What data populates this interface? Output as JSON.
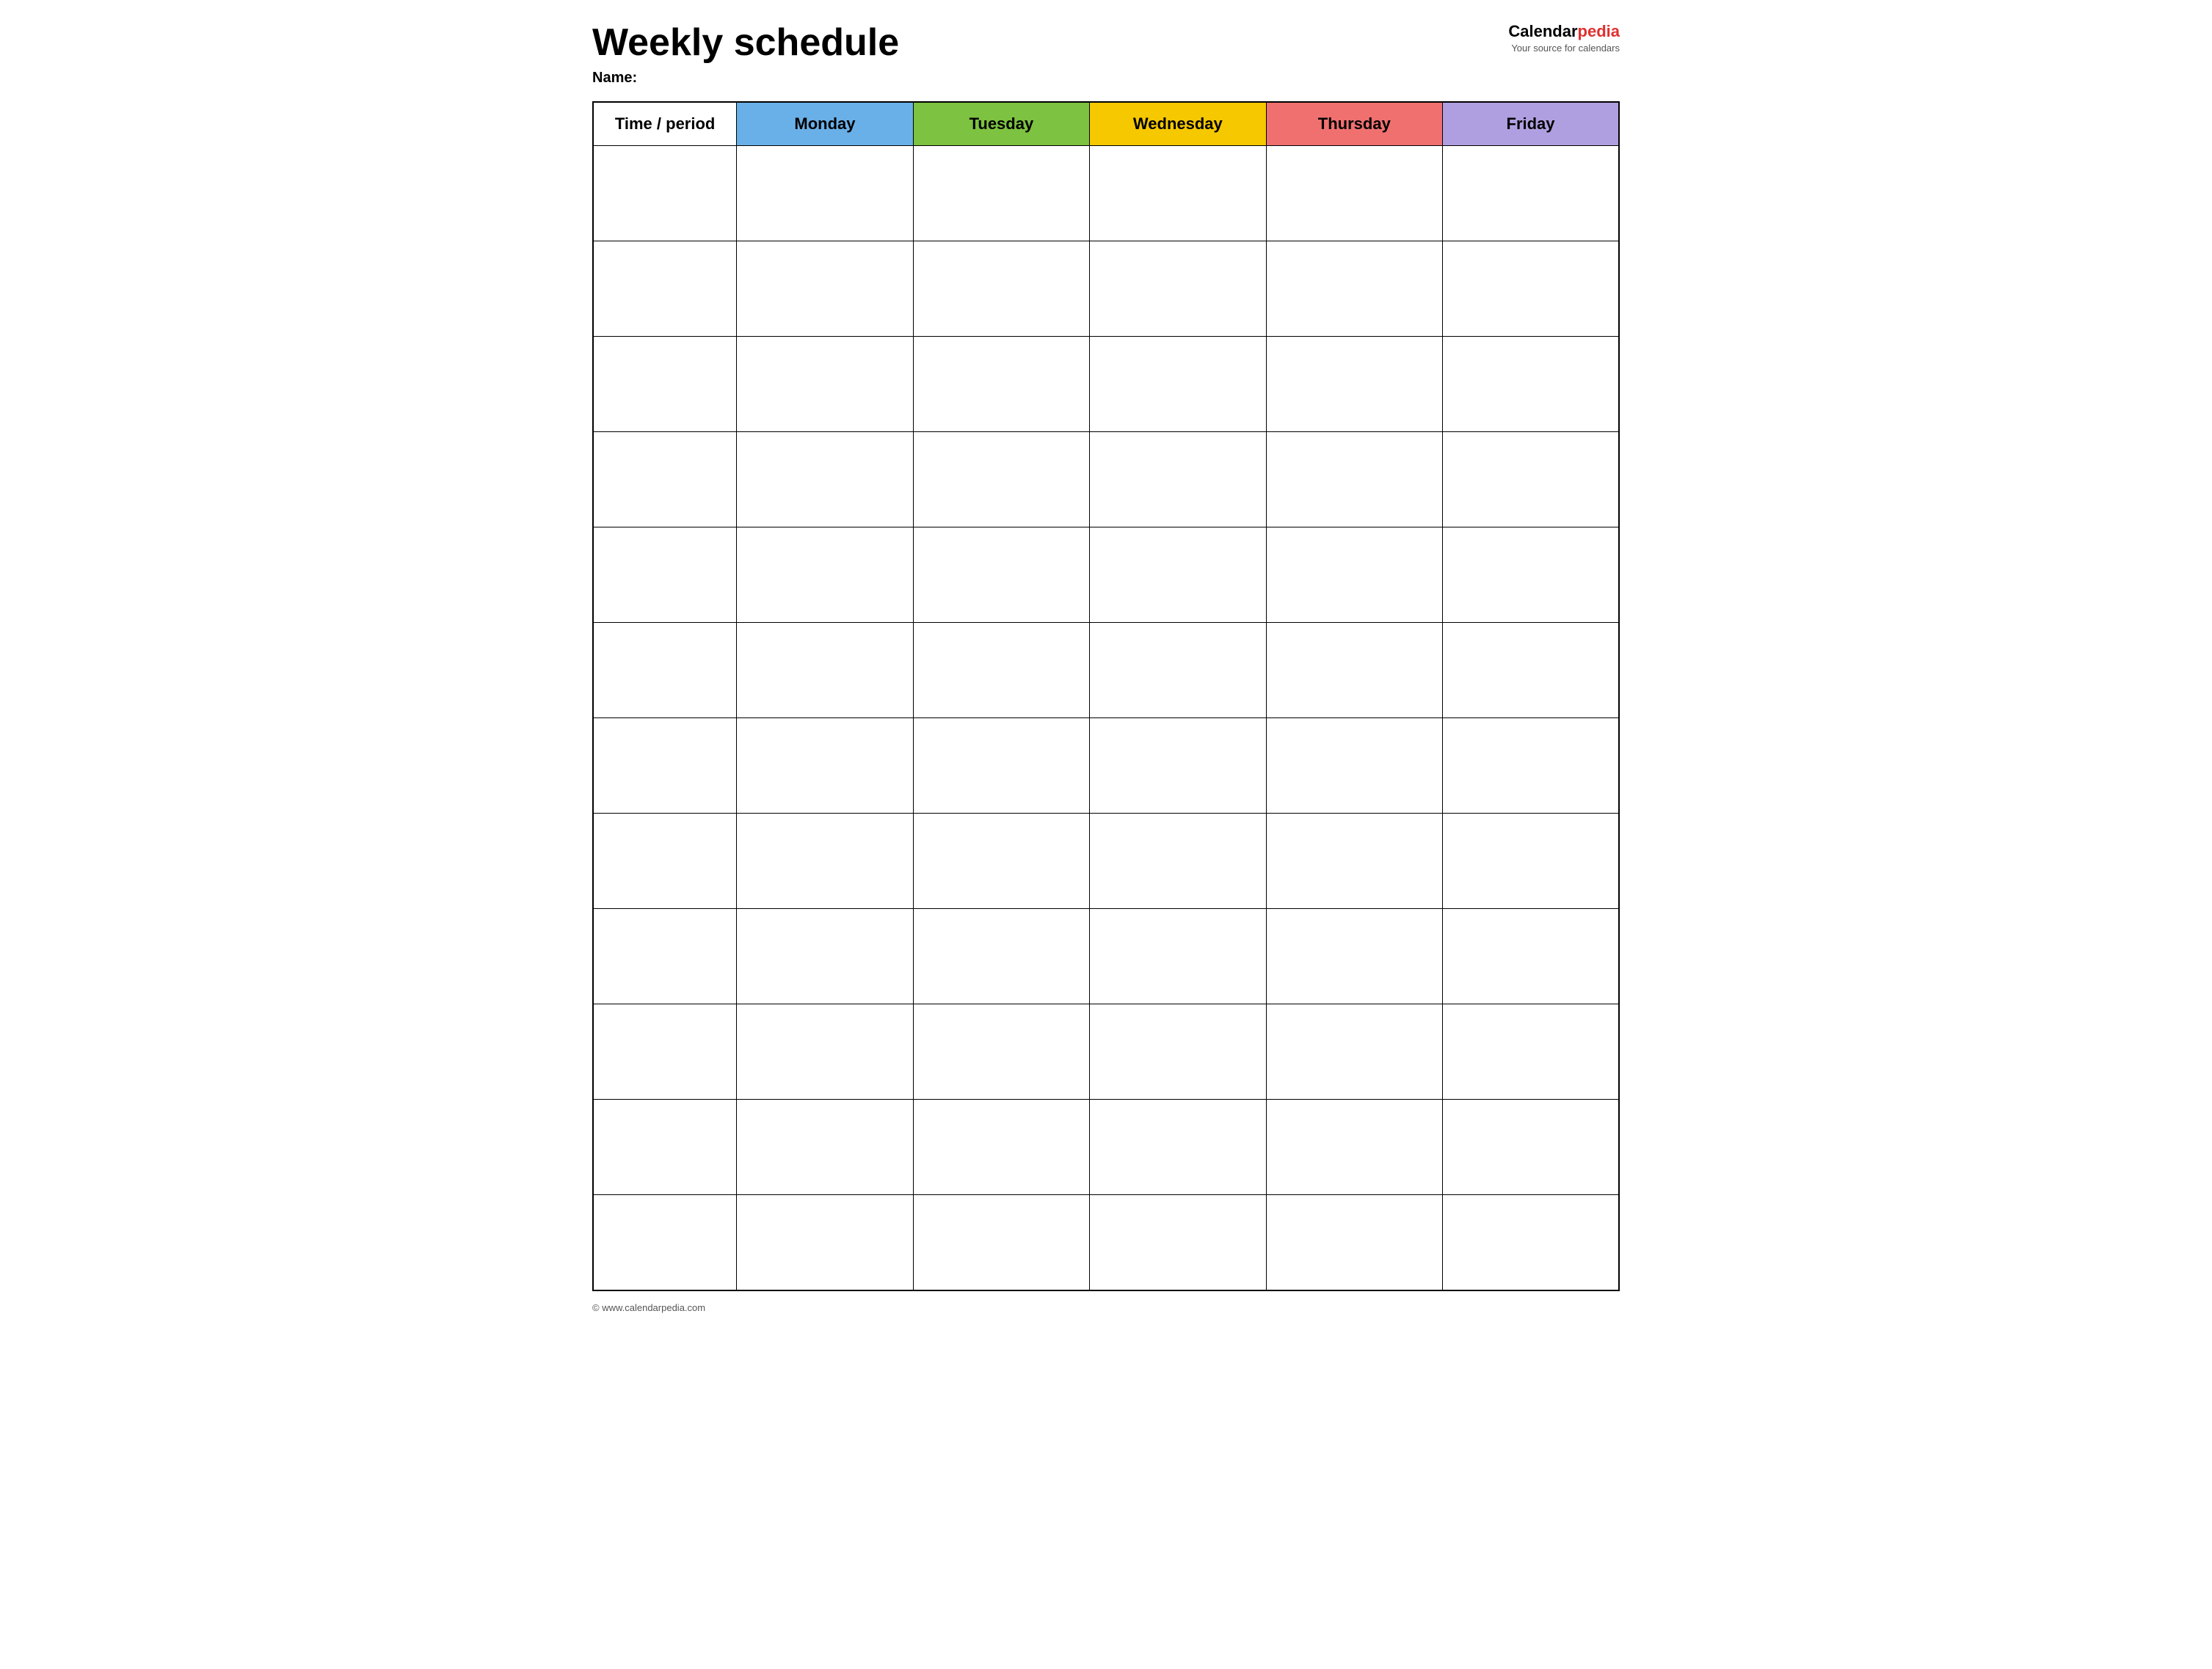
{
  "header": {
    "title": "Weekly schedule",
    "name_label": "Name:",
    "logo": {
      "brand_part1": "Calendar",
      "brand_part2": "pedia",
      "tagline": "Your source for calendars"
    }
  },
  "table": {
    "columns": [
      {
        "key": "time",
        "label": "Time / period",
        "color": "#ffffff"
      },
      {
        "key": "monday",
        "label": "Monday",
        "color": "#6ab0e8"
      },
      {
        "key": "tuesday",
        "label": "Tuesday",
        "color": "#7dc240"
      },
      {
        "key": "wednesday",
        "label": "Wednesday",
        "color": "#f5c800"
      },
      {
        "key": "thursday",
        "label": "Thursday",
        "color": "#f07070"
      },
      {
        "key": "friday",
        "label": "Friday",
        "color": "#b09fe0"
      }
    ],
    "row_count": 12
  },
  "footer": {
    "url": "© www.calendarpedia.com"
  }
}
